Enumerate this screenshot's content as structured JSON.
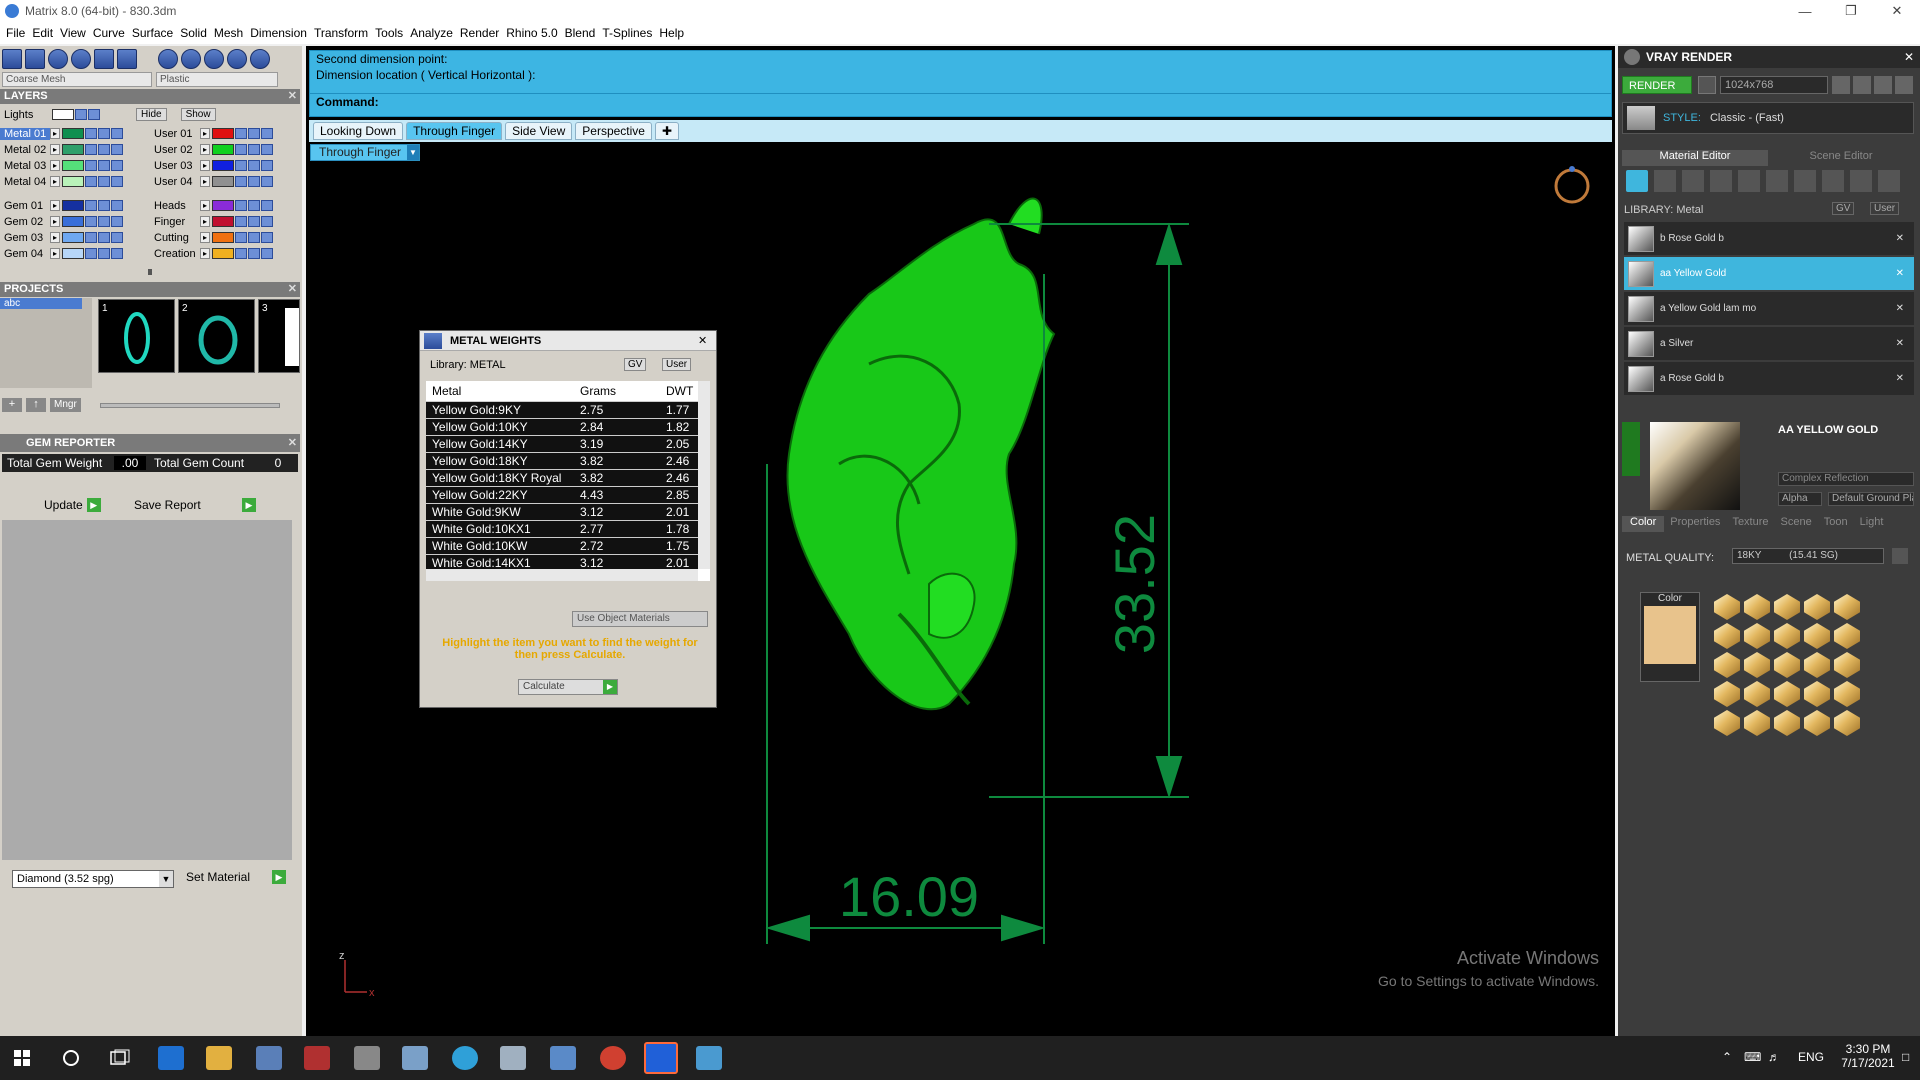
{
  "window": {
    "title": "Matrix 8.0 (64-bit) - 830.3dm"
  },
  "menu": [
    "File",
    "Edit",
    "View",
    "Curve",
    "Surface",
    "Solid",
    "Mesh",
    "Dimension",
    "Transform",
    "Tools",
    "Analyze",
    "Render",
    "Rhino 5.0",
    "Blend",
    "T-Splines",
    "Help"
  ],
  "left": {
    "mesh_combo": "Coarse Mesh",
    "material_combo": "Plastic",
    "layers_title": "LAYERS",
    "lights_label": "Lights",
    "hide_label": "Hide",
    "show_label": "Show",
    "layers_left": [
      {
        "name": "Metal 01",
        "color": "#0f8f4f"
      },
      {
        "name": "Metal 02",
        "color": "#2e9f6a"
      },
      {
        "name": "Metal 03",
        "color": "#55e07a"
      },
      {
        "name": "Metal 04",
        "color": "#b9f2b9"
      },
      {
        "name": "Gem 01",
        "color": "#1530a0"
      },
      {
        "name": "Gem 02",
        "color": "#3a6fd8"
      },
      {
        "name": "Gem 03",
        "color": "#6fa8f0"
      },
      {
        "name": "Gem 04",
        "color": "#b7d6f8"
      }
    ],
    "layers_right": [
      {
        "name": "User 01",
        "color": "#e01010"
      },
      {
        "name": "User 02",
        "color": "#10d020"
      },
      {
        "name": "User 03",
        "color": "#1020e0"
      },
      {
        "name": "User 04",
        "color": "#909090"
      },
      {
        "name": "Heads",
        "color": "#8a2bd8"
      },
      {
        "name": "Finger",
        "color": "#c01030"
      },
      {
        "name": "Cutting",
        "color": "#f07010"
      },
      {
        "name": "Creation",
        "color": "#f0b020"
      }
    ],
    "projects_title": "PROJECTS",
    "project_item": "abc",
    "project_nums": [
      "1",
      "2",
      "3"
    ],
    "mngr_label": "Mngr",
    "gem_reporter_title": "GEM REPORTER",
    "total_gem_weight_label": "Total Gem Weight",
    "total_gem_weight_value": ".00",
    "total_gem_count_label": "Total Gem Count",
    "total_gem_count_value": "0",
    "update_label": "Update",
    "save_report_label": "Save Report",
    "diamond_select": "Diamond     (3.52 spg)",
    "set_material_label": "Set Material"
  },
  "command": {
    "line1": "Second dimension point:",
    "line2": "Dimension location ( Vertical  Horizontal ):",
    "prompt": "Command:"
  },
  "view_tabs": [
    {
      "label": "Looking Down",
      "active": false
    },
    {
      "label": "Through Finger",
      "active": true
    },
    {
      "label": "Side View",
      "active": false
    },
    {
      "label": "Perspective",
      "active": false
    }
  ],
  "view_dropdown": "Through Finger",
  "viewport": {
    "dim_vertical": "33.52",
    "dim_horizontal": "16.09",
    "axis_z": "z",
    "axis_x": "x",
    "watermark1": "Activate Windows",
    "watermark2": "Go to Settings to activate Windows."
  },
  "metal_weights": {
    "title": "METAL WEIGHTS",
    "library_label": "Library: METAL",
    "gv_label": "GV",
    "user_label": "User",
    "col_metal": "Metal",
    "col_grams": "Grams",
    "col_dwt": "DWT",
    "rows": [
      [
        "Yellow Gold:9KY",
        "2.75",
        "1.77"
      ],
      [
        "Yellow Gold:10KY",
        "2.84",
        "1.82"
      ],
      [
        "Yellow Gold:14KY",
        "3.19",
        "2.05"
      ],
      [
        "Yellow Gold:18KY",
        "3.82",
        "2.46"
      ],
      [
        "Yellow Gold:18KY Royal",
        "3.82",
        "2.46"
      ],
      [
        "Yellow Gold:22KY",
        "4.43",
        "2.85"
      ],
      [
        "White Gold:9KW",
        "3.12",
        "2.01"
      ],
      [
        "White Gold:10KX1",
        "2.77",
        "1.78"
      ],
      [
        "White Gold:10KW",
        "2.72",
        "1.75"
      ],
      [
        "White Gold:14KX1",
        "3.12",
        "2.01"
      ]
    ],
    "use_object_materials": "Use Object Materials",
    "hint": "Highlight the item you want to find the weight for then press Calculate.",
    "calculate_label": "Calculate"
  },
  "vray": {
    "title": "VRAY RENDER",
    "render_label": "RENDER",
    "resolution": "1024x768",
    "style_label": "STYLE:",
    "style_value": "Classic - (Fast)",
    "tab_material_editor": "Material Editor",
    "tab_scene_editor": "Scene Editor",
    "library_label": "LIBRARY: Metal",
    "gv_label": "GV",
    "user_label": "User",
    "materials": [
      {
        "name": "b Rose Gold b",
        "selected": false
      },
      {
        "name": "aa Yellow Gold",
        "selected": true
      },
      {
        "name": "a Yellow Gold lam mo",
        "selected": false
      },
      {
        "name": "a Silver",
        "selected": false
      },
      {
        "name": "a Rose Gold b",
        "selected": false
      }
    ],
    "selected_title": "AA YELLOW GOLD",
    "reflection": "Complex Reflection",
    "alpha_label": "Alpha",
    "ground_plane": "Default Ground Plane",
    "subtabs": [
      "Color",
      "Properties",
      "Texture",
      "Scene",
      "Toon",
      "Light"
    ],
    "metal_quality_label": "METAL QUALITY:",
    "metal_quality_value": "18KY          (15.41 SG)",
    "color_label": "Color",
    "swatch_color": "#e8c38c"
  },
  "taskbar": {
    "time": "3:30 PM",
    "date": "7/17/2021",
    "lang": "ENG"
  }
}
